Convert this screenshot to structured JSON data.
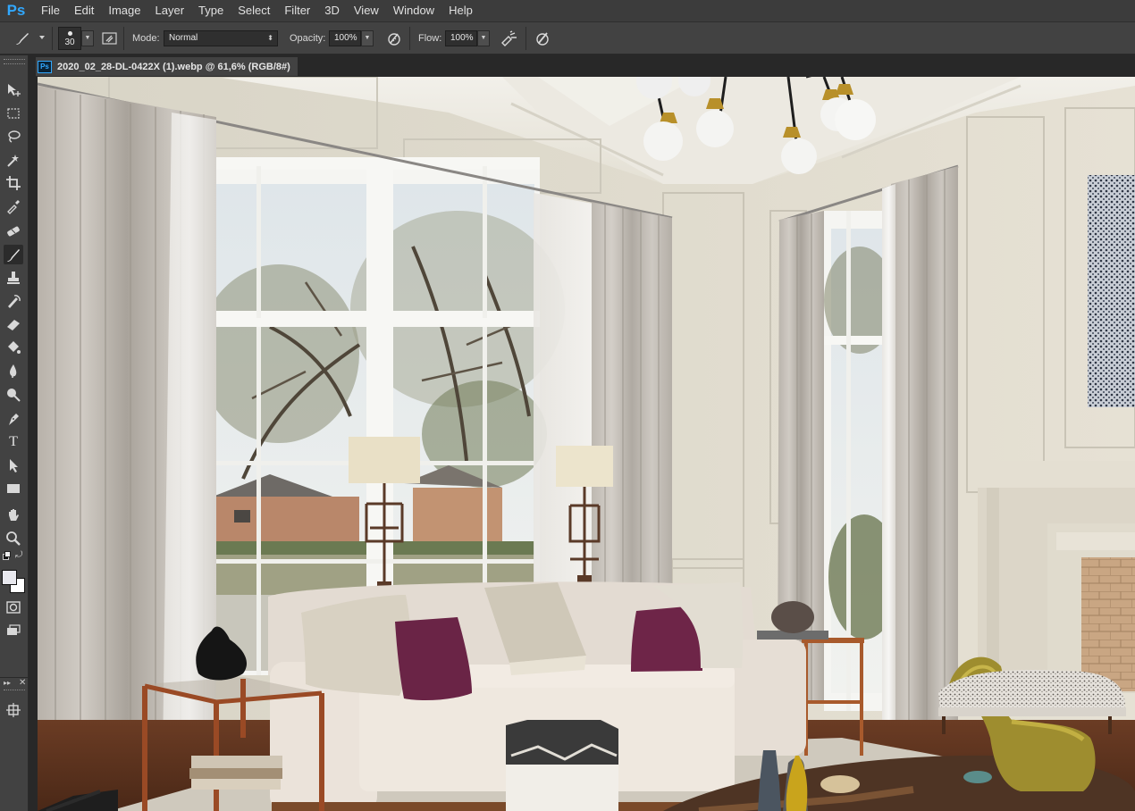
{
  "app": {
    "logo": "Ps"
  },
  "menu": [
    "File",
    "Edit",
    "Image",
    "Layer",
    "Type",
    "Select",
    "Filter",
    "3D",
    "View",
    "Window",
    "Help"
  ],
  "options": {
    "brush_size": "30",
    "mode_label": "Mode:",
    "mode_value": "Normal",
    "opacity_label": "Opacity:",
    "opacity_value": "100%",
    "flow_label": "Flow:",
    "flow_value": "100%"
  },
  "document": {
    "badge": "Ps",
    "tab_title": "2020_02_28-DL-0422X (1).webp @ 61,6% (RGB/8#)"
  },
  "toolbar": {
    "tools": [
      "move-tool-icon",
      "marquee-tool-icon",
      "lasso-tool-icon",
      "quick-select-icon",
      "crop-tool-icon",
      "eyedropper-icon",
      "healing-brush-icon",
      "brush-tool-icon",
      "clone-stamp-icon",
      "history-brush-icon",
      "eraser-icon",
      "paint-bucket-icon",
      "blur-tool-icon",
      "dodge-tool-icon",
      "pen-tool-icon",
      "type-tool-icon",
      "path-select-icon",
      "rectangle-tool-icon",
      "hand-tool-icon",
      "zoom-tool-icon"
    ],
    "active_tool": "brush-tool-icon",
    "type_tool_glyph": "T"
  },
  "colors": {
    "foreground": "#e8e8ee",
    "background": "#ffffff",
    "accent": "#31a8ff"
  }
}
